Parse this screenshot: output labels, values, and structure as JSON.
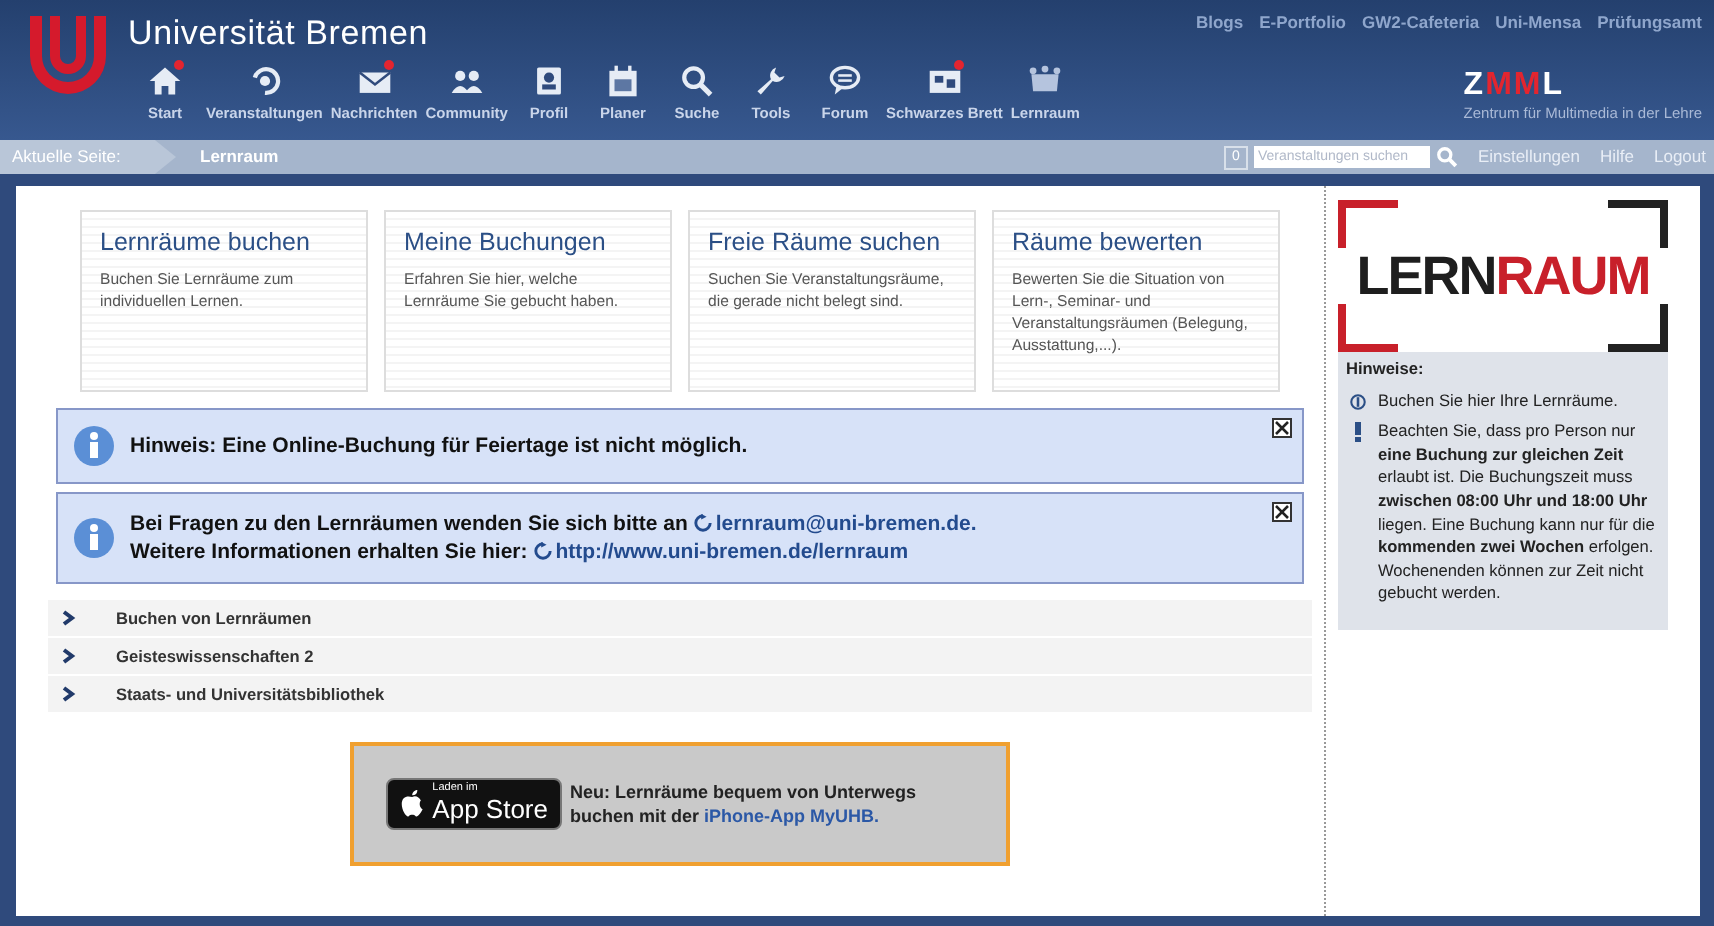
{
  "header": {
    "title": "Universität Bremen",
    "top_links": [
      "Blogs",
      "E-Portfolio",
      "GW2-Cafeteria",
      "Uni-Mensa",
      "Prüfungsamt"
    ],
    "nav": [
      {
        "label": "Start",
        "notification": true
      },
      {
        "label": "Veranstaltungen",
        "notification": false
      },
      {
        "label": "Nachrichten",
        "notification": true
      },
      {
        "label": "Community",
        "notification": false
      },
      {
        "label": "Profil",
        "notification": false
      },
      {
        "label": "Planer",
        "notification": false
      },
      {
        "label": "Suche",
        "notification": false
      },
      {
        "label": "Tools",
        "notification": false
      },
      {
        "label": "Forum",
        "notification": false
      },
      {
        "label": "Schwarzes Brett",
        "notification": true
      },
      {
        "label": "Lernraum",
        "notification": false
      }
    ],
    "zmml": {
      "letters": [
        {
          "text": "Z",
          "color": "#ffffff"
        },
        {
          "text": "MM",
          "color": "#e3252f"
        },
        {
          "text": "L",
          "color": "#ffffff"
        }
      ],
      "subtitle": "Zentrum für Multimedia in der Lehre"
    }
  },
  "breadcrumb": {
    "label": "Aktuelle Seite:",
    "current": "Lernraum",
    "counter": "0",
    "search": {
      "placeholder": "Veranstaltungen suchen"
    },
    "links": [
      "Einstellungen",
      "Hilfe",
      "Logout"
    ]
  },
  "tiles": [
    {
      "title": "Lernräume buchen",
      "text": "Buchen Sie Lernräume zum individuellen Lernen."
    },
    {
      "title": "Meine Buchungen",
      "text": "Erfahren Sie hier, welche Lernräume Sie gebucht haben."
    },
    {
      "title": "Freie Räume suchen",
      "text": "Suchen Sie Veranstaltungsräume, die gerade nicht belegt sind."
    },
    {
      "title": "Räume bewerten",
      "text": "Bewerten Sie die Situation von Lern-, Seminar- und Veranstaltungsräumen (Belegung, Ausstattung,...)."
    }
  ],
  "alerts": [
    {
      "lines": [
        {
          "text": "Hinweis: Eine Online-Buchung für Feiertage ist nicht möglich."
        }
      ]
    },
    {
      "lines": [
        {
          "text": "Bei Fragen zu den Lernräumen wenden Sie sich bitte an",
          "link": "lernraum@uni-bremen.de."
        },
        {
          "text": "Weitere Informationen erhalten Sie hier:",
          "link": "http://www.uni-bremen.de/lernraum"
        }
      ]
    }
  ],
  "sections": [
    {
      "label": "Buchen von Lernräumen",
      "expanded": false
    },
    {
      "label": "Geisteswissenschaften 2",
      "expanded": false
    },
    {
      "label": "Staats- und Universitätsbibliothek",
      "expanded": false
    }
  ],
  "app_promo": {
    "badge_small": "Laden im",
    "badge_large": "App Store",
    "text": "Neu: Lernräume bequem von Unterwegs buchen mit der",
    "link": "iPhone-App MyUHB."
  },
  "sidebar": {
    "logo": [
      {
        "text": "LERN",
        "color": "#1e1e1e"
      },
      {
        "text": "RAUM",
        "color": "#c8202a"
      }
    ],
    "heading": "Hinweise:",
    "notes": [
      {
        "kind": "info",
        "text": "Buchen Sie hier Ihre Lernräume."
      },
      {
        "kind": "warning",
        "text": "Beachten Sie, dass pro Person nur **eine Buchung zur gleichen Zeit** erlaubt ist. Die Buchungszeit muss **zwischen 08:00 Uhr und 18:00 Uhr** liegen. Eine Buchung kann nur für die **kommenden zwei Wochen** erfolgen. Wochenenden können zur Zeit nicht gebucht werden."
      }
    ]
  }
}
